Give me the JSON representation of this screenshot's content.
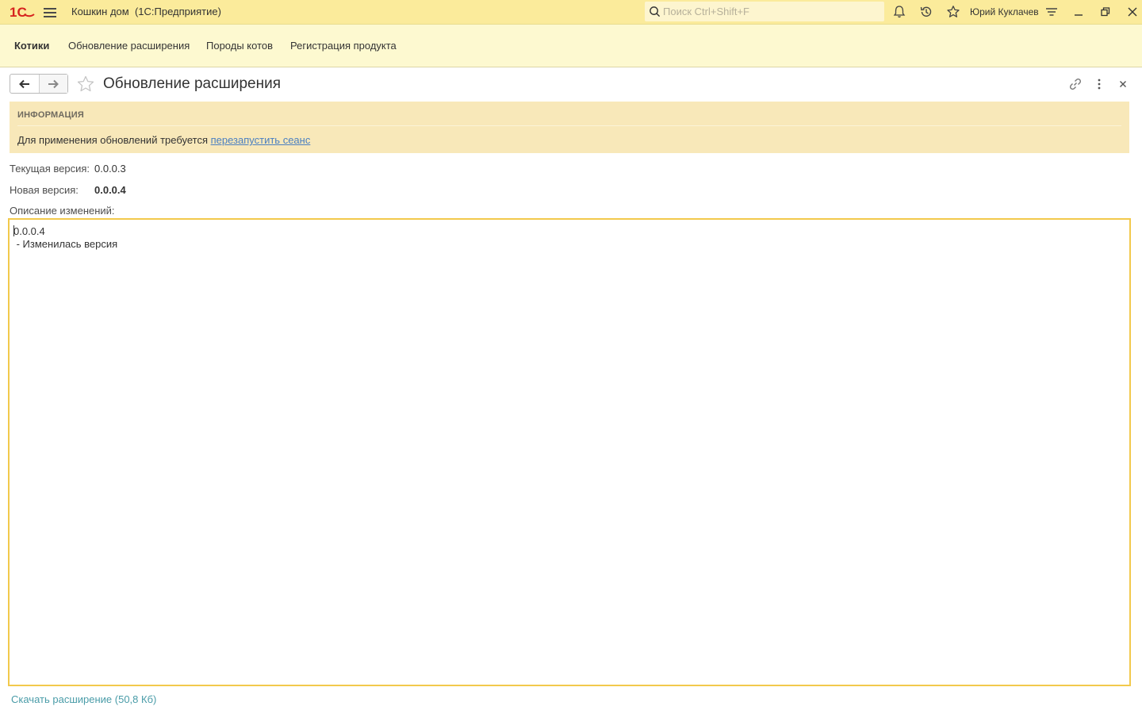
{
  "titlebar": {
    "app_title": "Кошкин дом  (1С:Предприятие)",
    "search_placeholder": "Поиск Ctrl+Shift+F",
    "user_name": "Юрий Куклачев",
    "accent_color": "#fbeb9b",
    "logo_color": "#d6231e"
  },
  "sections": {
    "items": [
      {
        "label": "Котики",
        "active": true
      },
      {
        "label": "Обновление расширения",
        "active": false
      },
      {
        "label": "Породы котов",
        "active": false
      },
      {
        "label": "Регистрация продукта",
        "active": false
      }
    ]
  },
  "form": {
    "title": "Обновление расширения",
    "info": {
      "heading": "ИНФОРМАЦИЯ",
      "text": "Для применения обновлений требуется ",
      "link": "перезапустить сеанс"
    },
    "current_version_label": "Текущая версия:",
    "current_version": "0.0.0.3",
    "new_version_label": "Новая версия:",
    "new_version": "0.0.0.4",
    "description_label": "Описание изменений:",
    "description_line1": "0.0.0.4",
    "description_line2": " - Изменилась версия",
    "download_link": "Скачать расширение (50,8 Кб)"
  }
}
